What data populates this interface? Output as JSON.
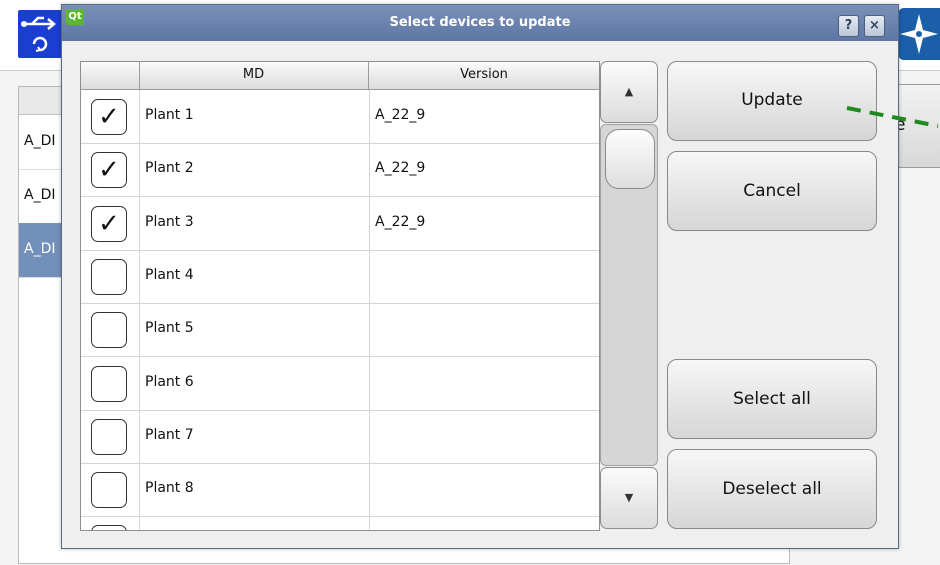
{
  "background": {
    "rows": [
      {
        "text": "A_DI",
        "selected": false
      },
      {
        "text": "A_DI",
        "selected": false
      },
      {
        "text": "A_DI",
        "selected": true
      }
    ],
    "side_button_text": "e"
  },
  "dialog": {
    "qt_icon_text": "Qt",
    "title": "Select devices to update",
    "help_button": "?",
    "close_button": "×",
    "table": {
      "columns": [
        "MD",
        "Version"
      ],
      "rows": [
        {
          "checked": true,
          "md": "Plant 1",
          "version": "A_22_9"
        },
        {
          "checked": true,
          "md": "Plant 2",
          "version": "A_22_9"
        },
        {
          "checked": true,
          "md": "Plant 3",
          "version": "A_22_9"
        },
        {
          "checked": false,
          "md": "Plant 4",
          "version": ""
        },
        {
          "checked": false,
          "md": "Plant 5",
          "version": ""
        },
        {
          "checked": false,
          "md": "Plant 6",
          "version": ""
        },
        {
          "checked": false,
          "md": "Plant 7",
          "version": ""
        },
        {
          "checked": false,
          "md": "Plant 8",
          "version": ""
        }
      ]
    },
    "scrollbar": {
      "up": "▲",
      "down": "▼"
    },
    "buttons": {
      "update": "Update",
      "cancel": "Cancel",
      "select_all": "Select all",
      "deselect_all": "Deselect all"
    }
  },
  "colors": {
    "title_bar": "#6a82ae",
    "selected_row": "#7390ba",
    "annotation_line": "#1f8a1f"
  }
}
